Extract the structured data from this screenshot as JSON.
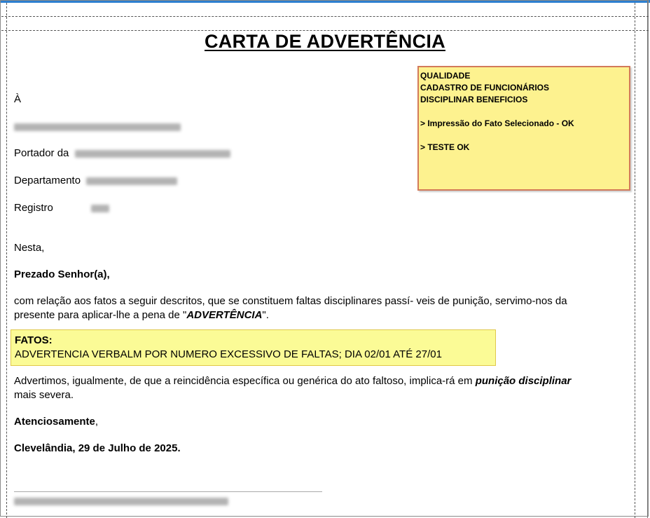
{
  "document": {
    "title": "CARTA DE ADVERTÊNCIA",
    "addressee_prefix": "À",
    "portador_label": "Portador da",
    "departamento_label": "Departamento",
    "registro_label": "Registro",
    "nesta": "Nesta,",
    "salutation": "Prezado Senhor(a),",
    "body_part1": "com relação aos fatos a seguir descritos, que se constituem faltas disciplinares passí- veis de punição, servimo-nos da presente para aplicar-lhe a pena de \"",
    "body_emph": "ADVERTÊNCIA",
    "body_part3": "\".",
    "fatos_label": "FATOS:",
    "fatos_text": "ADVERTENCIA VERBALM POR NUMERO EXCESSIVO DE FALTAS; DIA 02/01 ATÉ 27/01",
    "warning_part1": "Advertimos, igualmente, de que a reincidência específica ou genérica do ato  faltoso,  implica-rá em ",
    "warning_emph": "punição disciplinar",
    "warning_part3": " mais severa.",
    "closing": "Atenciosamente",
    "closing_comma": ",",
    "place_date": "Clevelândia, 29 de Julho de 2025."
  },
  "sticky_note": {
    "line1": "QUALIDADE",
    "line2": "CADASTRO DE FUNCIONÁRIOS",
    "line3": "DISCIPLINAR BENEFICIOS",
    "line4": "> Impressão do Fato Selecionado - OK",
    "line5": "> TESTE OK"
  },
  "colors": {
    "note_bg": "#fdf28f",
    "note_border": "#d27a5a",
    "highlight_bg": "#fbfb96",
    "top_bar": "#2d7fd0"
  }
}
